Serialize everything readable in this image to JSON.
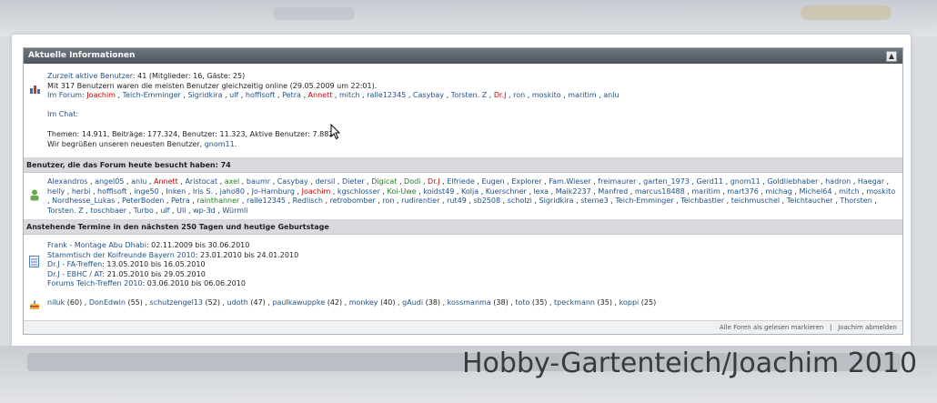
{
  "panel_title": "Aktuelle Informationen",
  "collapse_glyph": "▲",
  "online": {
    "prefix": "Zurzeit aktive Benutzer",
    "counts": ": 41 (Mitglieder: 16, Gäste: 25)",
    "record": "Mit 317 Benutzern waren die meisten Benutzer gleichzeitig online (29.05.2009 um 22:01).",
    "forum_label": "Im Forum:",
    "forum_users": [
      {
        "name": "Joachim",
        "c": "red"
      },
      {
        "name": "Teich-Emminger",
        "c": "blue"
      },
      {
        "name": "Sigridkira",
        "c": "blue"
      },
      {
        "name": "ulf",
        "c": "blue"
      },
      {
        "name": "hoffisoft",
        "c": "blue"
      },
      {
        "name": "Petra",
        "c": "blue"
      },
      {
        "name": "Annett",
        "c": "red"
      },
      {
        "name": "mitch",
        "c": "blue"
      },
      {
        "name": "ralle12345",
        "c": "blue"
      },
      {
        "name": "Casybay",
        "c": "blue"
      },
      {
        "name": "Torsten. Z",
        "c": "blue"
      },
      {
        "name": "Dr.J",
        "c": "red"
      },
      {
        "name": "ron",
        "c": "blue"
      },
      {
        "name": "moskito",
        "c": "blue"
      },
      {
        "name": "maritim",
        "c": "blue"
      },
      {
        "name": "anlu",
        "c": "blue"
      }
    ],
    "chat_label": "Im Chat:",
    "stats": "Themen: 14.911, Beiträge: 177.324, Benutzer: 11.323, Aktive Benutzer: 7.882",
    "welcome": "Wir begrüßen unseren neuesten Benutzer,",
    "newest": "gnom11",
    "welcome_end": "."
  },
  "today": {
    "title": "Benutzer, die das Forum heute besucht haben: 74",
    "users": [
      {
        "name": "Alexandros",
        "c": "blue"
      },
      {
        "name": "angel05",
        "c": "blue"
      },
      {
        "name": "anlu",
        "c": "blue"
      },
      {
        "name": "Annett",
        "c": "red"
      },
      {
        "name": "Aristocat",
        "c": "blue"
      },
      {
        "name": "axel",
        "c": "grn"
      },
      {
        "name": "baumr",
        "c": "blue"
      },
      {
        "name": "Casybay",
        "c": "blue"
      },
      {
        "name": "dersil",
        "c": "blue"
      },
      {
        "name": "Dieter",
        "c": "blue"
      },
      {
        "name": "Digicat",
        "c": "grn"
      },
      {
        "name": "Dodi",
        "c": "grn"
      },
      {
        "name": "Dr.J",
        "c": "red"
      },
      {
        "name": "Elfriede",
        "c": "blue"
      },
      {
        "name": "Eugen",
        "c": "blue"
      },
      {
        "name": "Explorer",
        "c": "blue"
      },
      {
        "name": "Fam.Wieser",
        "c": "blue"
      },
      {
        "name": "freimaurer",
        "c": "blue"
      },
      {
        "name": "garten_1973",
        "c": "blue"
      },
      {
        "name": "Gerd11",
        "c": "blue"
      },
      {
        "name": "gnom11",
        "c": "blue"
      },
      {
        "name": "Goldliebhaber",
        "c": "blue"
      },
      {
        "name": "hadron",
        "c": "blue"
      },
      {
        "name": "Haegar",
        "c": "blue"
      },
      {
        "name": "helly",
        "c": "blue"
      },
      {
        "name": "herbi",
        "c": "blue"
      },
      {
        "name": "hoffisoft",
        "c": "blue"
      },
      {
        "name": "inge50",
        "c": "blue"
      },
      {
        "name": "Inken",
        "c": "blue"
      },
      {
        "name": "Iris S.",
        "c": "blue"
      },
      {
        "name": "jaho80",
        "c": "blue"
      },
      {
        "name": "Jo-Hamburg",
        "c": "blue"
      },
      {
        "name": "Joachim",
        "c": "red"
      },
      {
        "name": "kgschlosser",
        "c": "blue"
      },
      {
        "name": "Koi-Uwe",
        "c": "grn"
      },
      {
        "name": "koidst49",
        "c": "blue"
      },
      {
        "name": "Kolja",
        "c": "blue"
      },
      {
        "name": "Kuerschner",
        "c": "blue"
      },
      {
        "name": "lexa",
        "c": "blue"
      },
      {
        "name": "Maik2237",
        "c": "blue"
      },
      {
        "name": "Manfred",
        "c": "blue"
      },
      {
        "name": "marcus18488",
        "c": "blue"
      },
      {
        "name": "maritim",
        "c": "blue"
      },
      {
        "name": "mart376",
        "c": "blue"
      },
      {
        "name": "michag",
        "c": "blue"
      },
      {
        "name": "Michel64",
        "c": "blue"
      },
      {
        "name": "mitch",
        "c": "blue"
      },
      {
        "name": "moskito",
        "c": "blue"
      },
      {
        "name": "Nordhesse_Lukas",
        "c": "blue"
      },
      {
        "name": "PeterBoden",
        "c": "blue"
      },
      {
        "name": "Petra",
        "c": "blue"
      },
      {
        "name": "rainthanner",
        "c": "grn"
      },
      {
        "name": "ralle12345",
        "c": "blue"
      },
      {
        "name": "Redlisch",
        "c": "blue"
      },
      {
        "name": "retrobomber",
        "c": "blue"
      },
      {
        "name": "ron",
        "c": "blue"
      },
      {
        "name": "rudirentier",
        "c": "blue"
      },
      {
        "name": "rut49",
        "c": "blue"
      },
      {
        "name": "sb2508",
        "c": "blue"
      },
      {
        "name": "scholzi",
        "c": "blue"
      },
      {
        "name": "Sigridkira",
        "c": "blue"
      },
      {
        "name": "sterne3",
        "c": "blue"
      },
      {
        "name": "Teich-Emminger",
        "c": "blue"
      },
      {
        "name": "Teichbastler",
        "c": "blue"
      },
      {
        "name": "teichmuschel",
        "c": "blue"
      },
      {
        "name": "Teichtaucher",
        "c": "blue"
      },
      {
        "name": "Thorsten",
        "c": "blue"
      },
      {
        "name": "Torsten. Z",
        "c": "blue"
      },
      {
        "name": "toschbaer",
        "c": "blue"
      },
      {
        "name": "Turbo",
        "c": "blue"
      },
      {
        "name": "ulf",
        "c": "blue"
      },
      {
        "name": "Uli",
        "c": "blue"
      },
      {
        "name": "wp-3d",
        "c": "blue"
      },
      {
        "name": "Würmli",
        "c": "blue"
      }
    ]
  },
  "events": {
    "title": "Anstehende Termine in den nächsten 250 Tagen und heutige Geburtstage",
    "items": [
      {
        "name": "Frank - Montage Abu Dhabi",
        "dates": ": 02.11.2009 bis 30.06.2010"
      },
      {
        "name": "Stammtisch der Koifreunde Bayern 2010",
        "dates": ": 23.01.2010 bis 24.01.2010"
      },
      {
        "name": "Dr.J - FA-Treffen",
        "dates": ": 13.05.2010 bis 16.05.2010"
      },
      {
        "name": "Dr.J - EBHC / AT",
        "dates": ": 21.05.2010 bis 29.05.2010"
      },
      {
        "name": "Forums Teich-Treffen 2010",
        "dates": ": 03.06.2010 bis 06.06.2010"
      }
    ],
    "birthdays": [
      {
        "name": "niluk",
        "age": "(60)"
      },
      {
        "name": "DonEdwin",
        "age": "(55)"
      },
      {
        "name": "schutzengel13",
        "age": "(52)"
      },
      {
        "name": "udoth",
        "age": "(47)"
      },
      {
        "name": "paulkawuppke",
        "age": "(42)"
      },
      {
        "name": "monkey",
        "age": "(40)"
      },
      {
        "name": "gAudi",
        "age": "(38)"
      },
      {
        "name": "kossmanma",
        "age": "(38)"
      },
      {
        "name": "toto",
        "age": "(35)"
      },
      {
        "name": "tpeckmann",
        "age": "(35)"
      },
      {
        "name": "koppi",
        "age": "(25)"
      }
    ]
  },
  "footer": {
    "mark_read": "Alle Foren als gelesen markieren",
    "divider": "|",
    "logout": "Joachim abmelden"
  },
  "watermark": "Hobby-Gartenteich/Joachim 2010",
  "colors": {
    "header": "#5a6169",
    "link": "#21528a",
    "admin": "#cc0000",
    "moderator": "#208020"
  }
}
